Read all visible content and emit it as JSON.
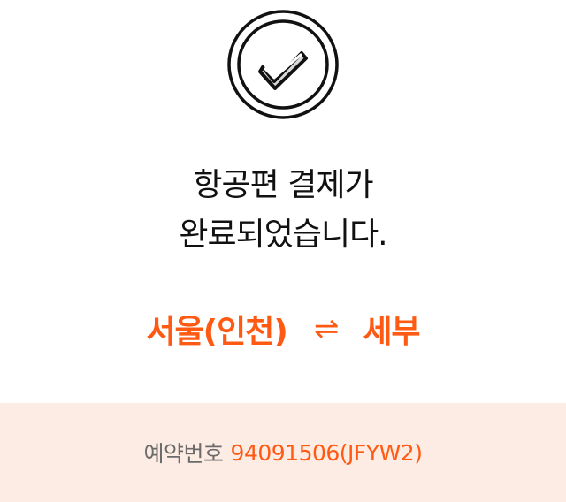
{
  "icons": {
    "success": "check-circle-icon"
  },
  "message": {
    "line1": "항공편 결제가",
    "line2": "완료되었습니다."
  },
  "route": {
    "origin": "서울(인천)",
    "separator": "⇌",
    "destination": "세부"
  },
  "reservation": {
    "label": "예약번호",
    "number": "94091506(JFYW2)"
  },
  "colors": {
    "accent": "#ff5a14",
    "reservation_bg": "#fdece3",
    "text": "#111111",
    "muted": "#6b6b6b"
  }
}
